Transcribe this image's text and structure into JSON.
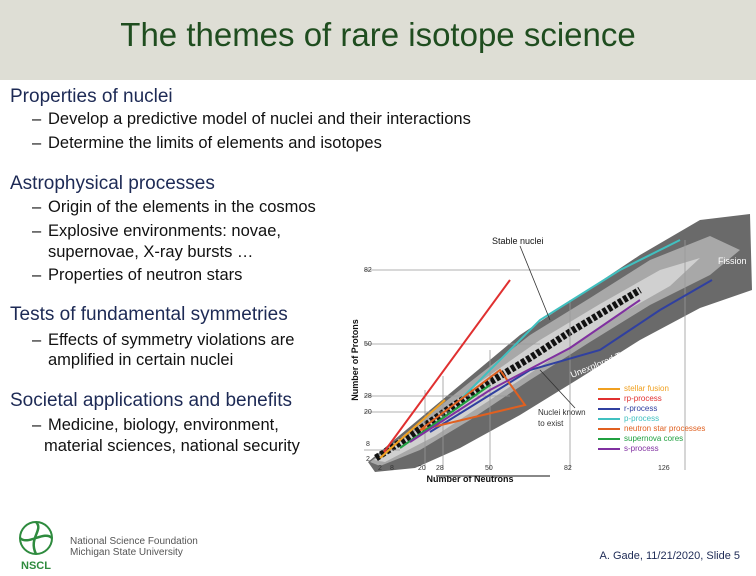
{
  "title": "The themes of rare isotope science",
  "sections": [
    {
      "heading": "Properties of nuclei",
      "bullets": [
        "Develop a predictive model of nuclei and their interactions",
        "Determine the limits of elements and isotopes"
      ]
    },
    {
      "heading": "Astrophysical processes",
      "bullets": [
        "Origin of the elements in the cosmos",
        "Explosive environments: novae,",
        "Properties of neutron stars"
      ],
      "continuation": "supernovae, X-ray bursts …"
    },
    {
      "heading": "Tests of fundamental symmetries",
      "bullets": [
        "Effects of symmetry violations are"
      ],
      "continuation": "amplified in certain nuclei"
    },
    {
      "heading": "Societal applications and benefits",
      "bullets": [
        "Medicine, biology, environment,"
      ],
      "continuation": "material sciences, national security"
    }
  ],
  "diagram": {
    "stable_nuclei": "Stable nuclei",
    "fission": "Fission",
    "unexplored": "Unexplored Territory",
    "nuclei_known": "Nuclei known",
    "to_exist": "to exist",
    "y_axis_label": "Number of Protons",
    "x_axis_label": "Number of Neutrons",
    "y_ticks": [
      "82",
      "50",
      "28",
      "20",
      "8",
      "2"
    ],
    "x_ticks": [
      "2",
      "8",
      "20",
      "28",
      "50",
      "82",
      "126"
    ],
    "legend": [
      {
        "label": "stellar fusion",
        "color": "#f0a020"
      },
      {
        "label": "rp-process",
        "color": "#e03030"
      },
      {
        "label": "r-process",
        "color": "#3040a0"
      },
      {
        "label": "p-process",
        "color": "#40c0c0"
      },
      {
        "label": "neutron star processes",
        "color": "#e06020"
      },
      {
        "label": "supernova cores",
        "color": "#20a040"
      },
      {
        "label": "s-process",
        "color": "#8030a0"
      }
    ]
  },
  "footer": {
    "org1": "National Science Foundation",
    "org2": "Michigan State University",
    "logo_text": "NSCL",
    "slide_info": "A. Gade, 11/21/2020, Slide 5"
  }
}
